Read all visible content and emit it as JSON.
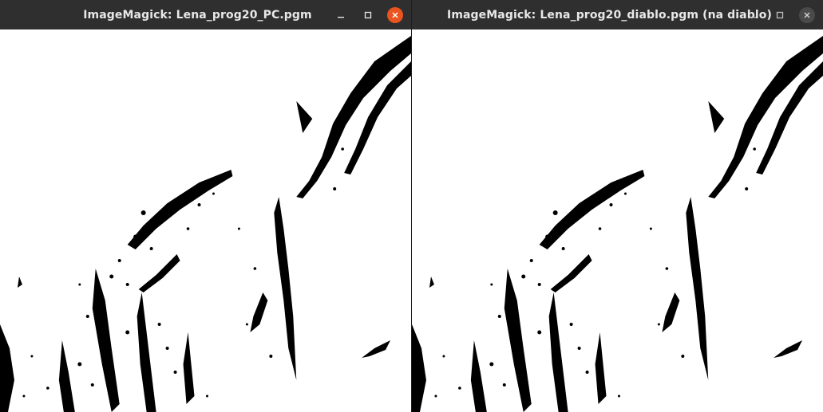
{
  "windows": [
    {
      "title": "ImageMagick: Lena_prog20_PC.pgm",
      "state": "active",
      "controls": [
        "minimize-icon",
        "maximize-icon",
        "close-icon"
      ]
    },
    {
      "title": "ImageMagick: Lena_prog20_diablo.pgm (na diablo)",
      "state": "inactive",
      "controls": [
        "minimize-icon",
        "maximize-icon",
        "close-icon"
      ]
    }
  ],
  "colors": {
    "titlebar": "#2f2f2f",
    "title_text": "#e8e8e8",
    "close_active": "#e95420",
    "image_background": "#ffffff",
    "image_ink": "#000000"
  }
}
